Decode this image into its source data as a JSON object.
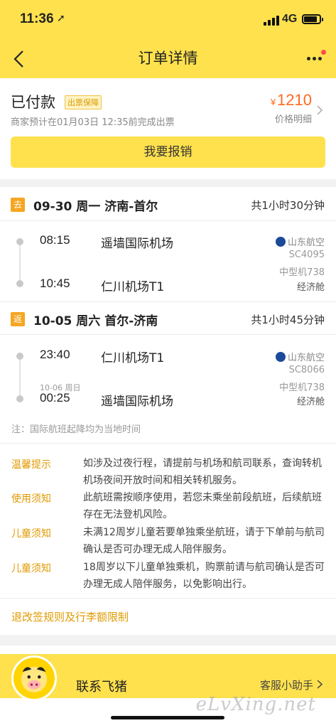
{
  "status_bar": {
    "time": "11:36",
    "location_icon": "location-arrow-icon",
    "network": "4G"
  },
  "nav": {
    "title": "订单详情",
    "back_icon": "chevron-left-icon",
    "more_icon": "more-dots-icon"
  },
  "payment": {
    "status": "已付款",
    "tag": "出票保障",
    "note": "商家预计在01月03日 12:35前完成出票",
    "currency": "¥",
    "price": "1210",
    "price_detail": "价格明细",
    "refund_button": "我要报销"
  },
  "outbound": {
    "badge": "去",
    "title": "09-30 周一 济南-首尔",
    "duration": "共1小时30分钟",
    "dep_time": "08:15",
    "dep_airport": "遥墙国际机场",
    "arr_time": "10:45",
    "arr_airport": "仁川机场T1",
    "airline": "山东航空",
    "flight_no": "SC4095",
    "aircraft": "中型机738",
    "cabin": "经济舱"
  },
  "return": {
    "badge": "返",
    "title": "10-05 周六 首尔-济南",
    "duration": "共1小时45分钟",
    "dep_time": "23:40",
    "dep_airport": "仁川机场T1",
    "arr_date": "10-06 周日",
    "arr_time": "00:25",
    "arr_airport": "遥墙国际机场",
    "airline": "山东航空",
    "flight_no": "SC8066",
    "aircraft": "中型机738",
    "cabin": "经济舱"
  },
  "note": "注：国际航班起降均为当地时间",
  "tips": [
    {
      "label": "温馨提示",
      "text": "如涉及过夜行程，请提前与机场和航司联系，查询转机机场夜间开放时间和相关转机服务。"
    },
    {
      "label": "使用须知",
      "text": "此航班需按顺序使用，若您未乘坐前段航班，后续航班存在无法登机风险。"
    },
    {
      "label": "儿童须知",
      "text": "未满12周岁儿童若要单独乘坐航班，请于下单前与航司确认是否可办理无成人陪伴服务。"
    },
    {
      "label": "儿童须知",
      "text": "18周岁以下儿童单独乘机，购票前请与航司确认是否可办理无成人陪伴服务，以免影响出行。"
    }
  ],
  "rules_link": "退改签规则及行李额限制",
  "bottom": {
    "contact": "联系飞猪",
    "assistant": "客服小助手"
  },
  "watermark": "eLvXing.net"
}
